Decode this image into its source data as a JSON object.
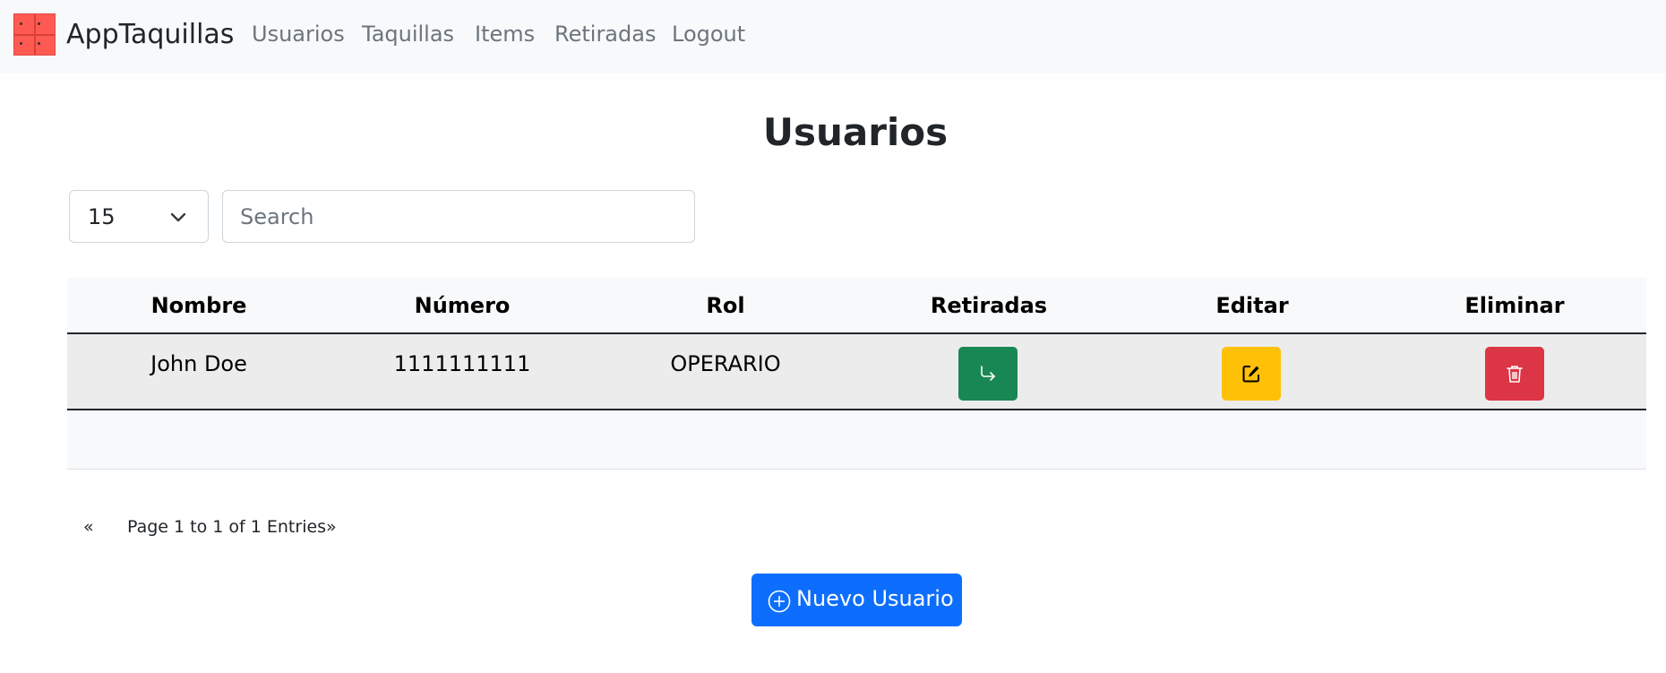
{
  "navbar": {
    "brand": "AppTaquillas",
    "links": [
      "Usuarios",
      "Taquillas",
      "Items",
      "Retiradas",
      "Logout"
    ]
  },
  "page": {
    "title": "Usuarios"
  },
  "controls": {
    "page_size": "15",
    "search_placeholder": "Search"
  },
  "table": {
    "headers": [
      "Nombre",
      "Número",
      "Rol",
      "Retiradas",
      "Editar",
      "Eliminar"
    ],
    "rows": [
      {
        "nombre": "John Doe",
        "numero": "1111111111",
        "rol": "OPERARIO"
      }
    ]
  },
  "pagination": {
    "prev": "«",
    "info": "Page 1 to 1 of 1 Entries",
    "next": "»"
  },
  "actions": {
    "new_user": "Nuevo Usuario"
  },
  "colors": {
    "navbar_bg": "#f8f9fa",
    "success": "#198754",
    "warning": "#ffc107",
    "danger": "#dc3545",
    "primary": "#0d6efd"
  }
}
